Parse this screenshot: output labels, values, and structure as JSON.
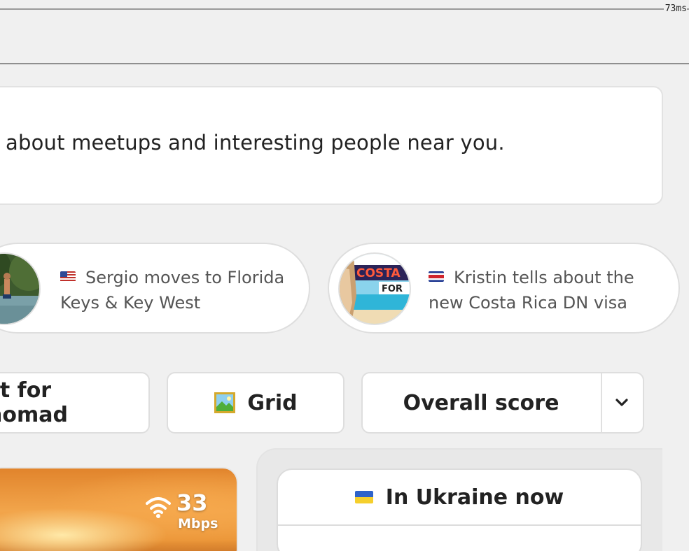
{
  "debug": {
    "timing": "73ms"
  },
  "notice": {
    "text": "about meetups and interesting people near you."
  },
  "stories": [
    {
      "flag": "US",
      "text": "Sergio moves to Florida Keys & Key West"
    },
    {
      "flag": "CR",
      "text": "Kristin tells about the new Costa Rica DN visa"
    }
  ],
  "controls": {
    "nomad_label": "st for nomad",
    "grid_label": "Grid",
    "sort_label": "Overall score"
  },
  "city_card": {
    "speed_value": "33",
    "speed_unit": "Mbps"
  },
  "side_panel": {
    "flag": "UA",
    "title": "In Ukraine now"
  },
  "icons": [
    "wifi-icon",
    "grid-icon",
    "chevron-down-icon",
    "us-flag-icon",
    "costa-rica-flag-icon",
    "ukraine-flag-icon"
  ]
}
